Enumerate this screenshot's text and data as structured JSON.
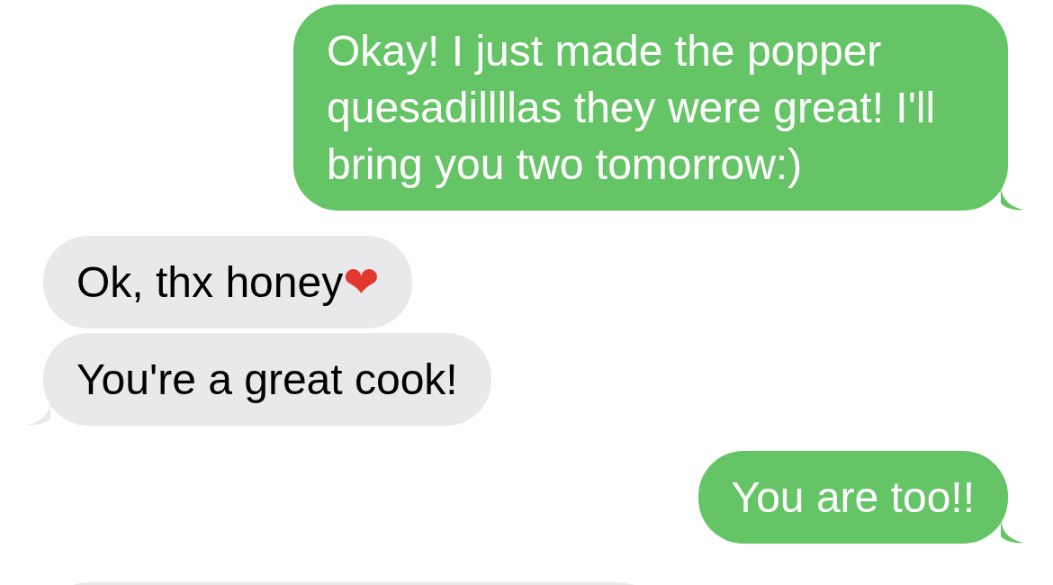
{
  "messages": [
    {
      "kind": "sent",
      "text": "Okay! I just made the popper quesadillllas they were great! I'll bring you two tomorrow:)",
      "tail": true
    },
    {
      "kind": "received",
      "text": "Ok, thx honey",
      "emoji": "❤",
      "tail": false
    },
    {
      "kind": "received",
      "text": "You're a great cook!",
      "tail": true
    },
    {
      "kind": "sent",
      "text": "You are too!!",
      "tail": true
    },
    {
      "kind": "received",
      "tail": false
    }
  ]
}
